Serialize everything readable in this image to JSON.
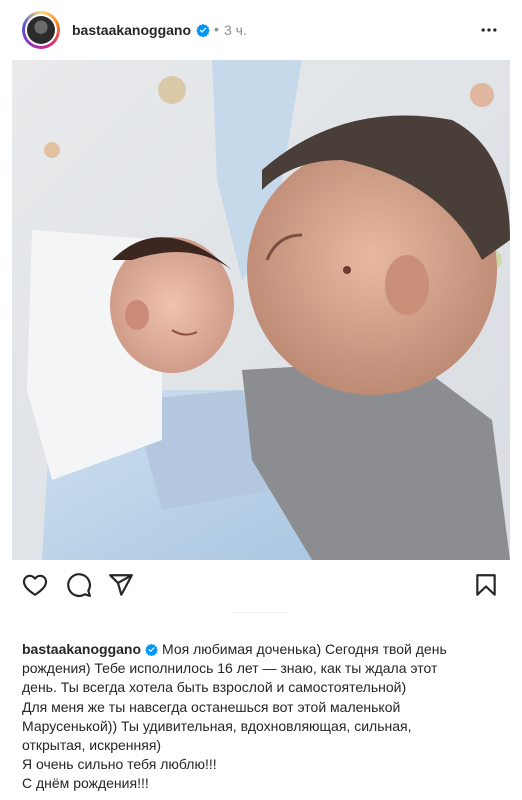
{
  "post": {
    "username": "bastaakanoggano",
    "time": "3 ч.",
    "dot": "•",
    "more_icon": "more-horizontal-icon",
    "verified_icon": "verified-badge-icon",
    "photo_alt": ""
  },
  "actions": {
    "like_icon": "heart-icon",
    "comment_icon": "comment-icon",
    "share_icon": "send-icon",
    "save_icon": "bookmark-icon"
  },
  "caption": {
    "username": "bastaakanoggano",
    "lines": [
      "Моя любимая доченька) Сегодня твой день",
      "рождения) Тебе исполнилось 16 лет — знаю, как ты ждала этот",
      "день. Ты всегда хотела быть взрослой и самостоятельной)",
      "Для меня же ты навсегда останешься вот этой маленькой",
      "Марусенькой)) Ты удивительная, вдохновляющая, сильная,",
      "открытая, искренняя)",
      "Я очень сильно тебя люблю!!!",
      "С днём рождения!!!"
    ]
  },
  "colors": {
    "text": "#262626",
    "muted": "#8e8e8e",
    "verified": "#0095f6"
  }
}
